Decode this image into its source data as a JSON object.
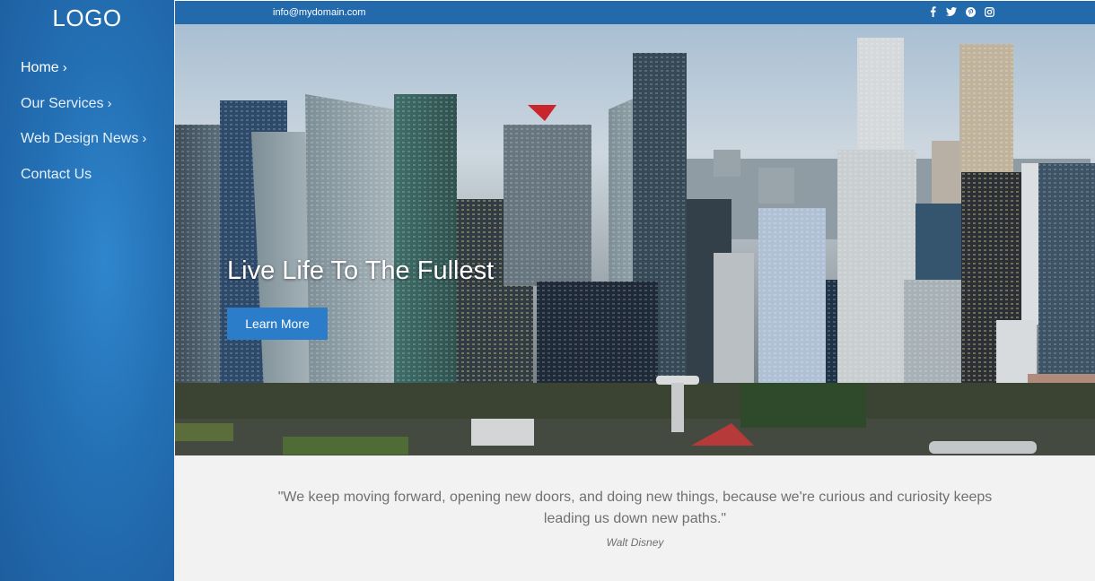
{
  "sidebar": {
    "logo": "LOGO",
    "nav": [
      {
        "label": "Home",
        "active": true
      },
      {
        "label": "Our Services",
        "active": false
      },
      {
        "label": "Web Design News",
        "active": false
      },
      {
        "label": "Contact Us",
        "active": false
      }
    ],
    "chevron": "›",
    "background_color": "#2470b5"
  },
  "topbar": {
    "email": "info@mydomain.com",
    "social_icons": [
      "facebook-icon",
      "twitter-icon",
      "pinterest-icon",
      "instagram-icon"
    ],
    "background_color": "#236aad"
  },
  "hero": {
    "title": "Live Life To The Fullest",
    "button_label": "Learn More",
    "button_color": "#2b7dc9",
    "image": "city-skyline-photo"
  },
  "quote": {
    "text": "\"We keep moving forward, opening new doors, and doing new things, because we're curious and curiosity keeps leading us down new paths.\"",
    "author": "Walt Disney"
  }
}
